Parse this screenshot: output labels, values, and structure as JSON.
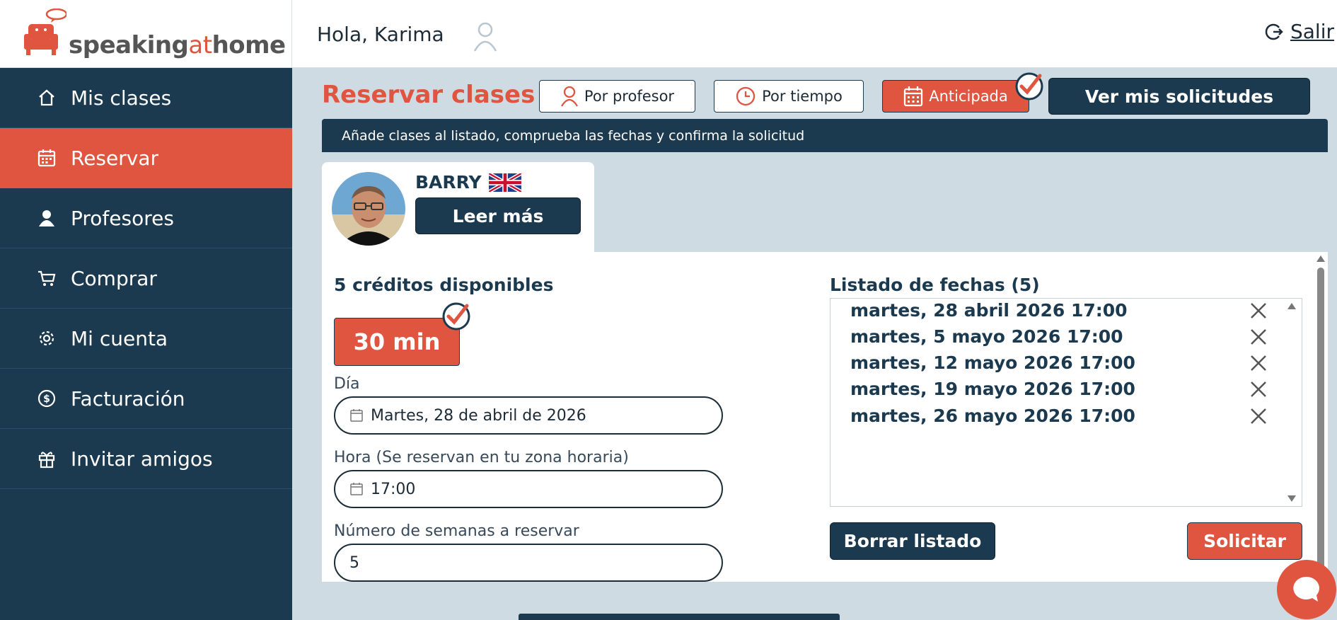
{
  "brand": {
    "name_pre": "speaking",
    "name_at": "at",
    "name_post": "home"
  },
  "header": {
    "greeting": "Hola, Karima",
    "logout_label": "Salir"
  },
  "sidebar": {
    "items": [
      {
        "label": "Mis clases",
        "icon": "home-icon"
      },
      {
        "label": "Reservar",
        "icon": "calendar-icon",
        "active": true
      },
      {
        "label": "Profesores",
        "icon": "person-icon"
      },
      {
        "label": "Comprar",
        "icon": "cart-icon"
      },
      {
        "label": "Mi cuenta",
        "icon": "gear-icon"
      },
      {
        "label": "Facturación",
        "icon": "dollar-icon"
      },
      {
        "label": "Invitar amigos",
        "icon": "gift-icon"
      }
    ]
  },
  "main": {
    "title": "Reservar clases",
    "modes": [
      {
        "label": "Por profesor",
        "icon": "person-icon"
      },
      {
        "label": "Por tiempo",
        "icon": "clock-icon"
      },
      {
        "label": "Anticipada",
        "icon": "calendar-icon",
        "active": true
      }
    ],
    "requests_button": "Ver mis solicitudes",
    "info": "Añade clases al listado, comprueba las fechas y confirma la solicitud"
  },
  "teacher": {
    "name": "BARRY",
    "flag": "uk-flag-icon",
    "read_more": "Leer más"
  },
  "booking": {
    "credits": "5 créditos disponibles",
    "duration": "30 min",
    "day_label": "Día",
    "day_value": "Martes, 28 de abril de 2026",
    "time_label": "Hora (Se reservan en tu zona horaria)",
    "time_value": "17:00",
    "weeks_label": "Número de semanas a reservar",
    "weeks_value": "5"
  },
  "dates": {
    "title": "Listado de fechas (5)",
    "items": [
      "martes, 28 abril 2026 17:00",
      "martes, 5 mayo 2026 17:00",
      "martes, 12 mayo 2026 17:00",
      "martes, 19 mayo 2026 17:00",
      "martes, 26 mayo 2026 17:00"
    ],
    "clear_button": "Borrar listado",
    "submit_button": "Solicitar"
  },
  "colors": {
    "navy": "#1c3a4f",
    "accent": "#e05540",
    "background": "#cfdbe2"
  }
}
